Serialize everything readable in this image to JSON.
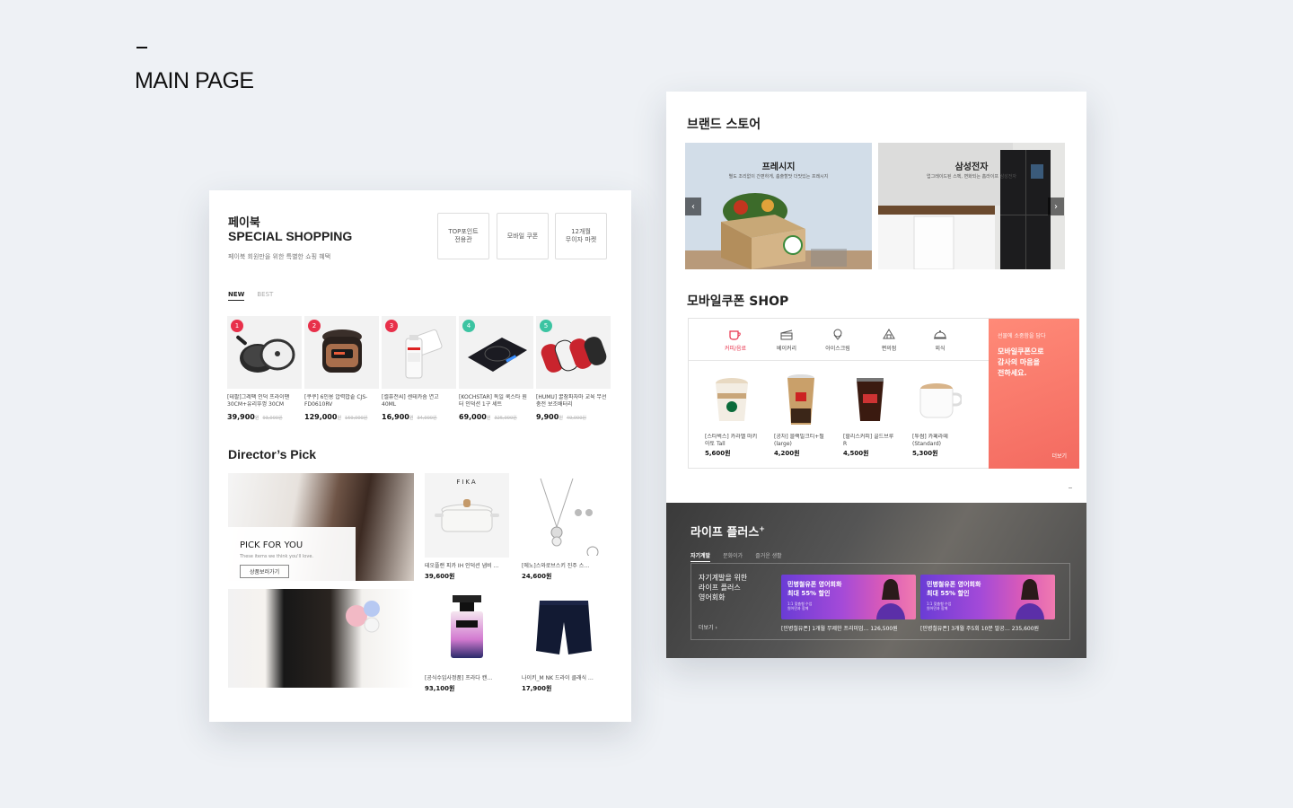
{
  "page_heading": "MAIN PAGE",
  "left_card": {
    "brand": "페이북",
    "special_title": "SPECIAL SHOPPING",
    "special_sub": "페이북 회원만을 위한 특별한 쇼핑 혜택",
    "quick_buttons": [
      "TOP포인트\n전용관",
      "모바일 쿠폰",
      "12개월\n무이자 마켓"
    ],
    "tabs": {
      "new": "NEW",
      "best": "BEST"
    },
    "products": [
      {
        "rank": "1",
        "name": "[테팔]그레팩 인덕 프라이팬 30CM+유리뚜껑 30CM",
        "price": "39,900",
        "unit": "원",
        "orig": "93,000원",
        "icon": "frying-pan-icon"
      },
      {
        "rank": "2",
        "name": "[쿠쿠] 6인용 압력밥솥 CJS-FD0610RV",
        "price": "129,000",
        "unit": "원",
        "orig": "159,000원",
        "icon": "rice-cooker-icon"
      },
      {
        "rank": "3",
        "name": "[셀퓨전씨] 센테카솜 연고 40ML",
        "price": "16,900",
        "unit": "원",
        "orig": "34,000원",
        "icon": "ointment-tube-icon"
      },
      {
        "rank": "4",
        "name": "[KOCHSTAR] 독일 쿡스타 원터 인덕션 1구 세트",
        "price": "69,000",
        "unit": "원",
        "orig": "325,000원",
        "icon": "induction-cooktop-icon"
      },
      {
        "rank": "5",
        "name": "[HUMU] 꿀잠파자마 교육 무선 충전 보조배터리",
        "price": "9,900",
        "unit": "원",
        "orig": "49,000원",
        "icon": "battery-packs-icon"
      }
    ],
    "directors_title": "Director’s Pick",
    "pick": {
      "title": "PICK FOR YOU",
      "sub": "These items we think you'll love.",
      "button": "상품보러가기"
    },
    "director_products": [
      {
        "name": "테오플랜 피카 IH 인덕션 냄비 …",
        "price": "39,600원",
        "brand": "FIKA",
        "icon": "casserole-pot-icon"
      },
      {
        "name": "[에노]스와로브스키 진주 스…",
        "price": "24,600원",
        "icon": "pearl-necklace-icon"
      },
      {
        "name": "[공식수입사정품] 프라다 캔…",
        "price": "93,100원",
        "icon": "perfume-bottle-icon"
      },
      {
        "name": "나이키_M NK 드라이 클래식 …",
        "price": "17,900원",
        "icon": "shorts-icon"
      }
    ]
  },
  "right_card": {
    "brand_store_title": "브랜드 스토어",
    "banners": [
      {
        "title": "프레시지",
        "sub": "별도 조리없이 간편하게, 춤출할맛 더맛있는 프레시지"
      },
      {
        "title": "삼성전자",
        "sub": "업그레이드된 스펙, 변화되는 홈라이프 삼성전자"
      }
    ],
    "coupon_title": "모바일쿠폰 SHOP",
    "categories": [
      {
        "label": "커피/음료",
        "icon": "coffee-cup-icon",
        "active": true
      },
      {
        "label": "베이커리",
        "icon": "cake-icon",
        "active": false
      },
      {
        "label": "아이스크림",
        "icon": "ice-cream-icon",
        "active": false
      },
      {
        "label": "편의점",
        "icon": "store-icon",
        "active": false
      },
      {
        "label": "외식",
        "icon": "dining-cloche-icon",
        "active": false
      }
    ],
    "coupons": [
      {
        "name": "[스타벅스] 카라멜 마키아토 Tall",
        "price": "5,600원"
      },
      {
        "name": "[공차] 블랙밀크티+펄 (large)",
        "price": "4,200원"
      },
      {
        "name": "[할리스커피] 콜드브루 R",
        "price": "4,500원"
      },
      {
        "name": "[투썸] 카페라떼 (Standard)",
        "price": "5,300원"
      }
    ],
    "gift": {
      "small": "선물에 소중함을 담다",
      "big": "모바일쿠폰으로\n감사의 마음을\n전하세요.",
      "more": "더보기"
    },
    "life": {
      "title": "라이프 플러스",
      "plus": "+",
      "tabs": [
        "자기계발",
        "문화이가",
        "즐거운 생활"
      ],
      "left_title": "자기계발을 위한\n라이프 플러스\n영어회화",
      "left_sup": "+",
      "more": "더보기",
      "ads": [
        {
          "head": "민병철유폰 영어회화\n최대 55% 할인",
          "foot": "1:1 맞춤형 수업\n원어민과 함께",
          "name": "[민병철유폰] 1개월 무제한 프리미엄… 126,500원"
        },
        {
          "head": "민병철유폰 영어회화\n최대 55% 할인",
          "foot": "1:1 맞춤형 수업\n원어민과 함께",
          "name": "[민병철유폰] 3개월 주5회 10분 말공… 235,600원"
        }
      ]
    }
  },
  "colors": {
    "background": "#eef1f5",
    "accent_red": "#e8304a",
    "rank_green": "#3cc4a2",
    "gift_coral": "#f36a60"
  }
}
